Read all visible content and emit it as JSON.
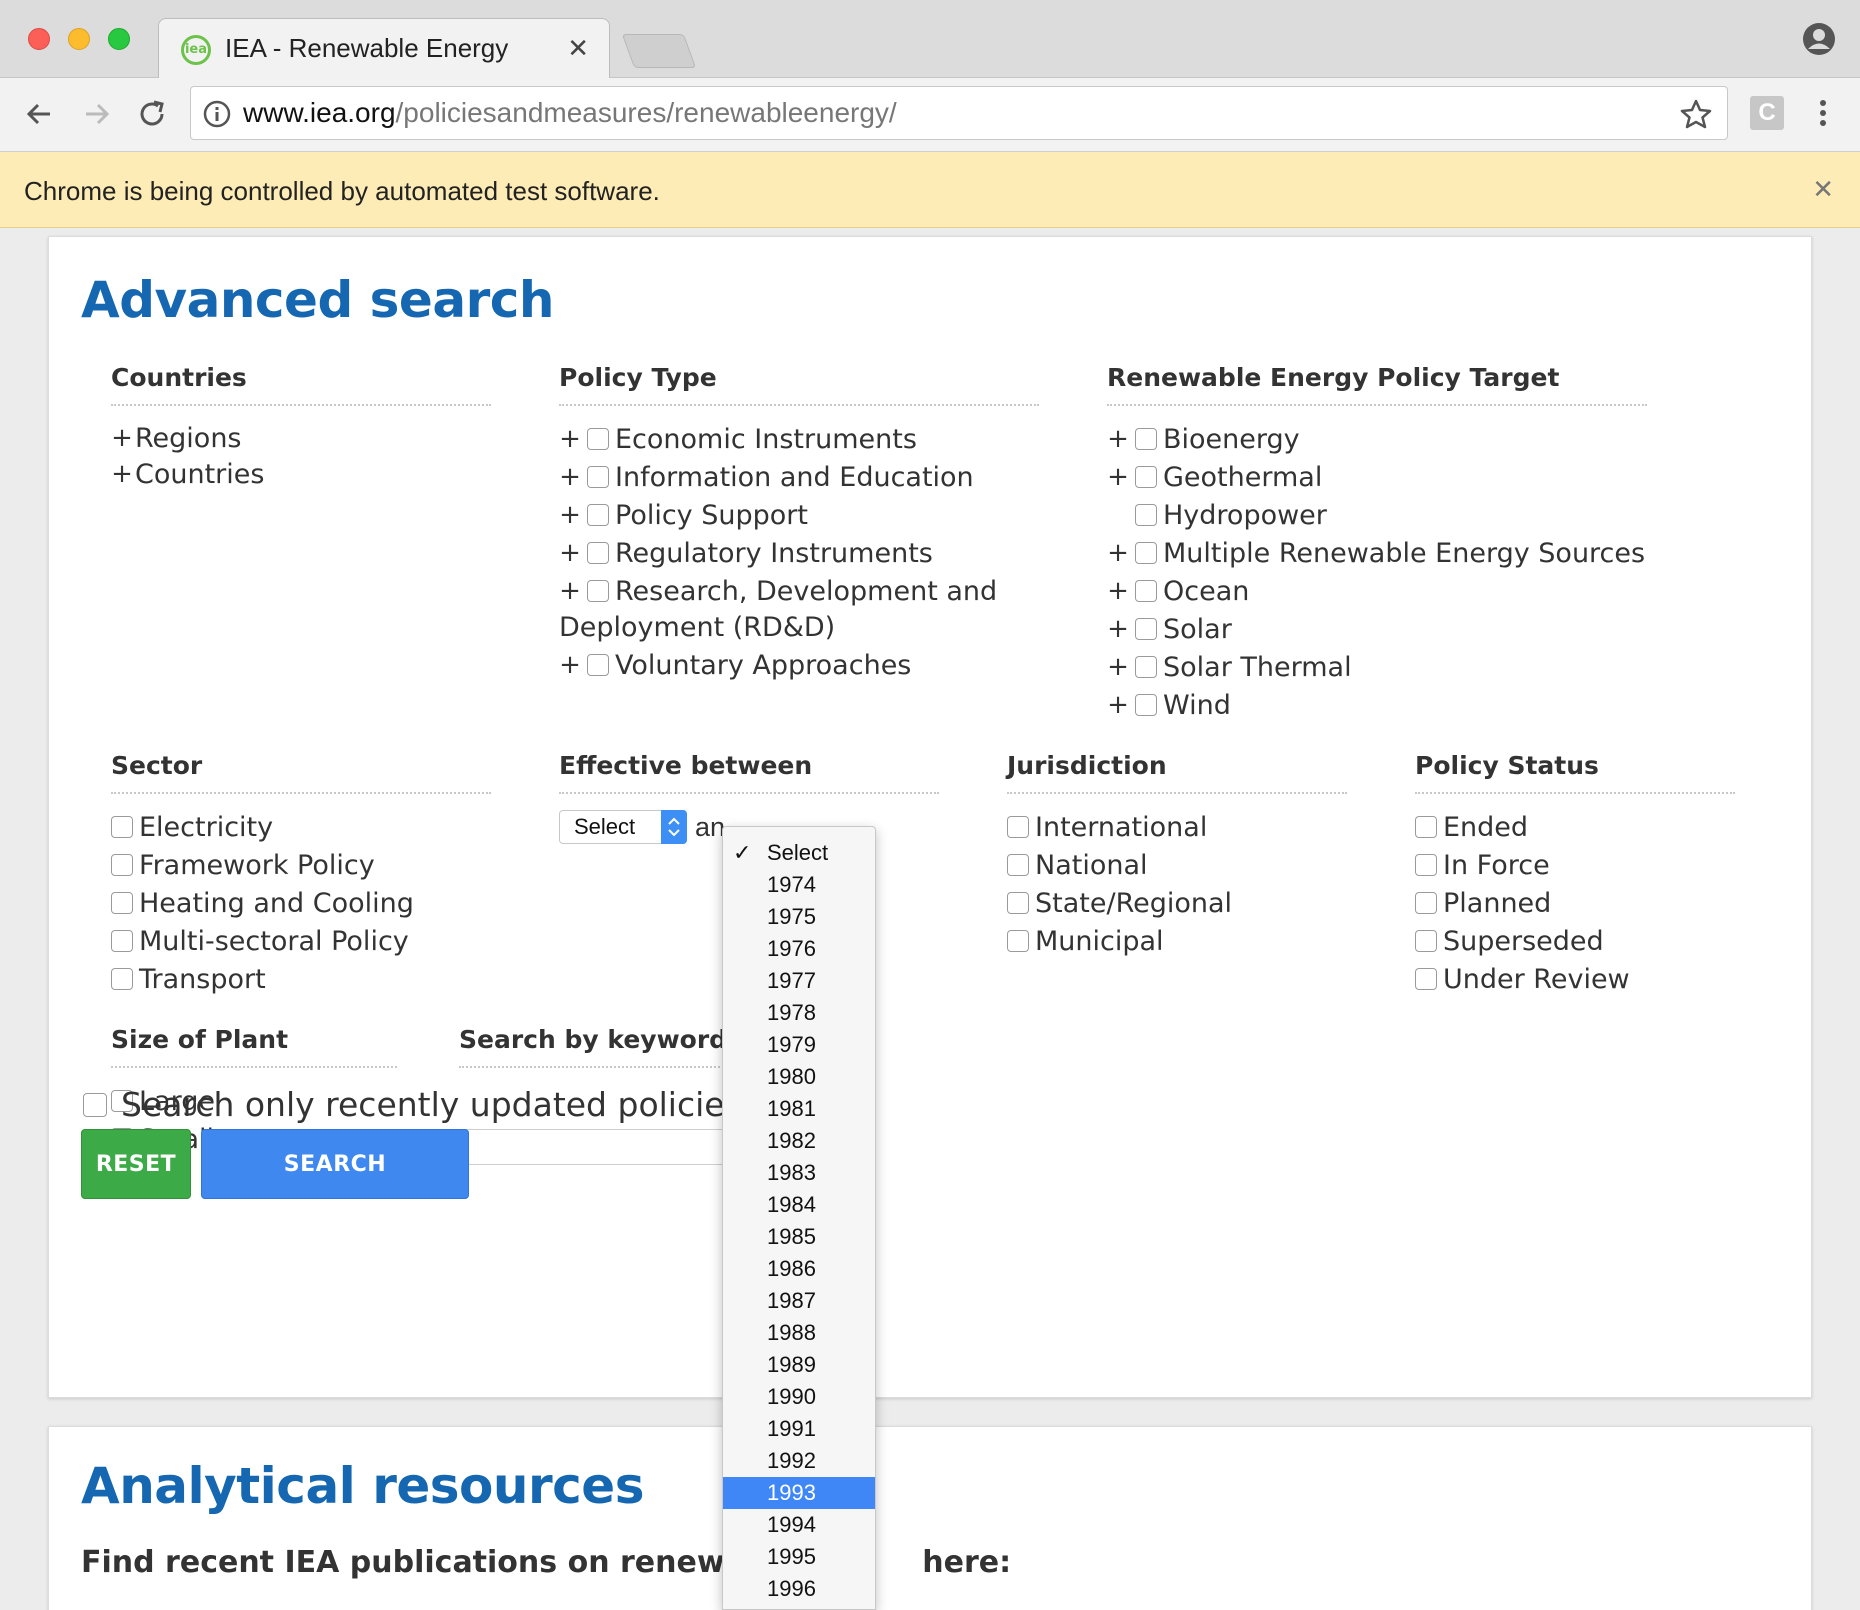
{
  "browser": {
    "tab_title": "IEA - Renewable Energy",
    "url_host": "www.iea.org",
    "url_path": "/policiesandmeasures/renewableenergy/",
    "infobar_text": "Chrome is being controlled by automated test software.",
    "ext_label": "C",
    "favicon_text": "iea"
  },
  "page": {
    "title": "Advanced search",
    "countries": {
      "title": "Countries",
      "items": [
        "Regions",
        "Countries"
      ]
    },
    "policy_type": {
      "title": "Policy Type",
      "items": [
        "Economic Instruments",
        "Information and Education",
        "Policy Support",
        "Regulatory Instruments",
        "Research, Development and",
        "Voluntary Approaches"
      ],
      "wrap_text": "Deployment (RD&D)"
    },
    "target": {
      "title": "Renewable Energy Policy Target",
      "items": [
        "Bioenergy",
        "Geothermal",
        "Hydropower",
        "Multiple Renewable Energy Sources",
        "Ocean",
        "Solar",
        "Solar Thermal",
        "Wind"
      ]
    },
    "sector": {
      "title": "Sector",
      "items": [
        "Electricity",
        "Framework Policy",
        "Heating and Cooling",
        "Multi-sectoral Policy",
        "Transport"
      ]
    },
    "effective": {
      "title": "Effective between",
      "select_value": "Select",
      "and_text": "an"
    },
    "jurisdiction": {
      "title": "Jurisdiction",
      "items": [
        "International",
        "National",
        "State/Regional",
        "Municipal"
      ]
    },
    "status": {
      "title": "Policy Status",
      "items": [
        "Ended",
        "In Force",
        "Planned",
        "Superseded",
        "Under Review"
      ]
    },
    "size": {
      "title": "Size of Plant",
      "items": [
        "Large",
        "Small"
      ]
    },
    "keyword": {
      "title": "Search by keyword(s"
    },
    "recent_label": "Search only recently updated policies",
    "reset_label": "RESET",
    "search_label": "SEARCH",
    "analytic_title": "Analytical resources",
    "analytic_sub_left": "Find recent IEA publications on renewab",
    "analytic_sub_right": "here:"
  },
  "dropdown": {
    "options": [
      "Select",
      "1974",
      "1975",
      "1976",
      "1977",
      "1978",
      "1979",
      "1980",
      "1981",
      "1982",
      "1983",
      "1984",
      "1985",
      "1986",
      "1987",
      "1988",
      "1989",
      "1990",
      "1991",
      "1992",
      "1993",
      "1994",
      "1995",
      "1996"
    ],
    "checked": "Select",
    "highlighted": "1993",
    "check_glyph": "✓"
  },
  "colors": {
    "accent_blue": "#1467b0",
    "reset_green": "#3daa48",
    "search_blue": "#3e88f0",
    "highlight": "#3f86f6"
  }
}
